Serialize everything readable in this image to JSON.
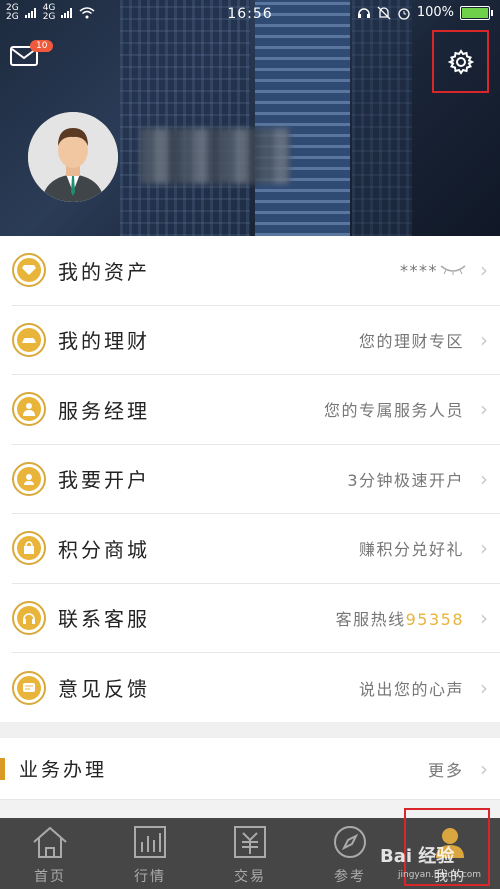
{
  "statusbar": {
    "network_top": "4G",
    "network_sim1": "2G",
    "network_sim2": "2G",
    "time": "16:56",
    "battery": "100%"
  },
  "header": {
    "mail_badge": "10",
    "icons": {
      "mail": "mail-icon",
      "settings": "gear-icon"
    }
  },
  "menu": [
    {
      "label": "我的资产",
      "value": "****",
      "icon": "diamond-icon",
      "extra_icon": "eye-closed-icon"
    },
    {
      "label": "我的理财",
      "value": "您的理财专区",
      "icon": "gold-ingot-icon"
    },
    {
      "label": "服务经理",
      "value": "您的专属服务人员",
      "icon": "manager-icon"
    },
    {
      "label": "我要开户",
      "value": "3分钟极速开户",
      "icon": "user-icon"
    },
    {
      "label": "积分商城",
      "value": "赚积分兑好礼",
      "icon": "gift-bag-icon"
    },
    {
      "label": "联系客服",
      "value": "客服热线",
      "value_highlight": "95358",
      "icon": "headset-icon"
    },
    {
      "label": "意见反馈",
      "value": "说出您的心声",
      "icon": "message-icon"
    }
  ],
  "business": {
    "title": "业务办理",
    "more": "更多"
  },
  "tabs": [
    {
      "label": "首页",
      "icon": "home-icon"
    },
    {
      "label": "行情",
      "icon": "chart-icon"
    },
    {
      "label": "交易",
      "icon": "trade-icon"
    },
    {
      "label": "参考",
      "icon": "compass-icon"
    },
    {
      "label": "我的",
      "icon": "profile-icon"
    }
  ],
  "watermark": {
    "text": "Bai 经验",
    "sub": "jingyan.baidu.com"
  },
  "colors": {
    "accent": "#e8b43a",
    "highlight_box": "#d9262a",
    "tabbar": "#464646"
  }
}
